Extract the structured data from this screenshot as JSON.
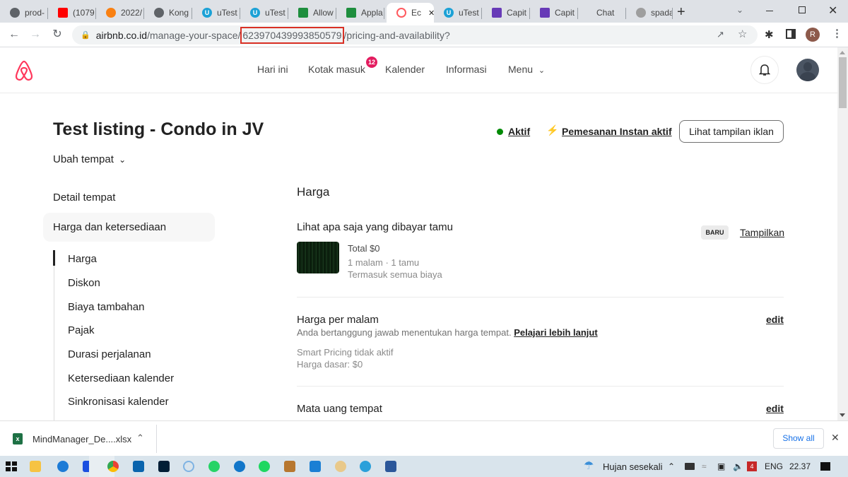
{
  "browser": {
    "tabs": [
      {
        "label": "prod-",
        "icon": "globe-icon",
        "color": "#5f6368"
      },
      {
        "label": "(1079",
        "icon": "youtube-icon",
        "color": "#ff0000"
      },
      {
        "label": "2022/",
        "icon": "moodle-icon",
        "color": "#f98012"
      },
      {
        "label": "Kong",
        "icon": "globe-icon",
        "color": "#5f6368"
      },
      {
        "label": "uTest",
        "icon": "utest-icon",
        "color": "#1ba1d6"
      },
      {
        "label": "uTest",
        "icon": "utest-icon",
        "color": "#1ba1d6"
      },
      {
        "label": "Allow",
        "icon": "sheets-icon",
        "color": "#1e8e3e"
      },
      {
        "label": "Appla",
        "icon": "sheets-icon",
        "color": "#1e8e3e"
      },
      {
        "label": "Ec",
        "icon": "airbnb-icon",
        "color": "#ff5a5f",
        "active": true
      },
      {
        "label": "uTest",
        "icon": "utest-icon",
        "color": "#1ba1d6"
      },
      {
        "label": "Capit",
        "icon": "forms-icon",
        "color": "#673ab7"
      },
      {
        "label": "Capit",
        "icon": "forms-icon",
        "color": "#673ab7"
      },
      {
        "label": "Chat",
        "icon": "none",
        "color": "#dee1e6"
      },
      {
        "label": "spada",
        "icon": "moodle-icon",
        "color": "#9e9e9e"
      }
    ],
    "url": {
      "prefix": "airbnb.co.id",
      "path1": "/manage-your-space/",
      "highlight": "623970439993850579",
      "path2": "/pricing-and-availability?"
    },
    "profile_initial": "R"
  },
  "header": {
    "nav": [
      "Hari ini",
      "Kotak masuk",
      "Kalender",
      "Informasi",
      "Menu"
    ],
    "inbox_badge": "12"
  },
  "listing": {
    "title": "Test listing - Condo in JV",
    "switch_label": "Ubah tempat",
    "status_active": "Aktif",
    "instant_booking": "Pemesanan Instan aktif",
    "view_listing_button": "Lihat tampilan iklan",
    "status_color": "#008a05",
    "bolt_color": "#ffb400"
  },
  "sidebar": {
    "sections": [
      "Detail tempat",
      "Harga dan ketersediaan"
    ],
    "subitems": [
      "Harga",
      "Diskon",
      "Biaya tambahan",
      "Pajak",
      "Durasi perjalanan",
      "Ketersediaan kalender",
      "Sinkronisasi kalender"
    ]
  },
  "main": {
    "heading": "Harga",
    "guest_preview": {
      "title": "Lihat apa saja yang dibayar tamu",
      "badge": "BARU",
      "action": "Tampilkan",
      "total": "Total $0",
      "stay": "1 malam · 1 tamu",
      "fees": "Termasuk semua biaya"
    },
    "nightly": {
      "title": "Harga per malam",
      "desc": "Anda bertanggung jawab menentukan harga tempat.",
      "learn_more": "Pelajari lebih lanjut",
      "smart_pricing": "Smart Pricing tidak aktif",
      "base_price": "Harga dasar: $0",
      "edit": "edit"
    },
    "currency": {
      "title": "Mata uang tempat",
      "edit": "edit"
    }
  },
  "downloads": {
    "file": "MindManager_De....xlsx",
    "show_all": "Show all"
  },
  "taskbar": {
    "weather": "Hujan sesekali",
    "lang": "ENG",
    "time": "22.37",
    "notif_count": "4"
  }
}
